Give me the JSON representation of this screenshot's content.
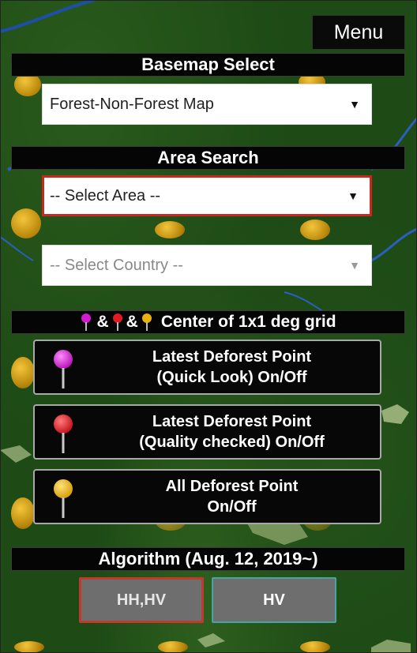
{
  "menu": {
    "label": "Menu"
  },
  "basemap": {
    "heading": "Basemap Select",
    "selected": "Forest-Non-Forest Map"
  },
  "area_search": {
    "heading": "Area Search",
    "area_select": "-- Select Area --",
    "country_select": "-- Select Country --"
  },
  "points": {
    "heading_separator": "&",
    "heading_text": "Center of 1x1 deg grid",
    "quick_look": {
      "line1": "Latest Deforest Point",
      "line2": "(Quick Look) On/Off",
      "pin_color": "#d21ad2"
    },
    "quality": {
      "line1": "Latest Deforest Point",
      "line2": "(Quality checked) On/Off",
      "pin_color": "#e01b24"
    },
    "all": {
      "line1": "All Deforest Point",
      "line2": "On/Off",
      "pin_color": "#e8b10e"
    }
  },
  "algorithm": {
    "heading": "Algorithm (Aug. 12, 2019~)",
    "options": [
      "HH,HV",
      "HV"
    ],
    "selected": "HH,HV"
  },
  "colors": {
    "panel_bg": "#050505",
    "selected_border": "#c8281f",
    "forest_green": "#1d4a15",
    "grid_point": "#d9a21a"
  }
}
